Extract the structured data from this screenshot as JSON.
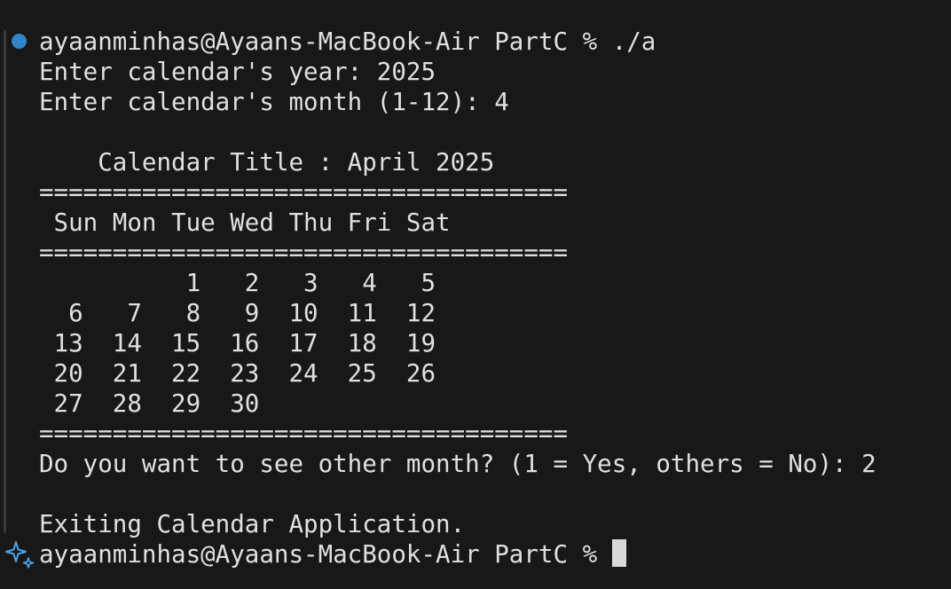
{
  "terminal": {
    "lines": [
      "ayaanminhas@Ayaans-MacBook-Air PartC % ./a",
      "Enter calendar's year: 2025",
      "Enter calendar's month (1-12): 4",
      "",
      "    Calendar Title : April 2025",
      "====================================",
      " Sun Mon Tue Wed Thu Fri Sat",
      "====================================",
      "          1   2   3   4   5",
      "  6   7   8   9  10  11  12",
      " 13  14  15  16  17  18  19",
      " 20  21  22  23  24  25  26",
      " 27  28  29  30",
      "====================================",
      "Do you want to see other month? (1 = Yes, others = No): 2",
      "",
      "Exiting Calendar Application.",
      "ayaanminhas@Ayaans-MacBook-Air PartC % "
    ],
    "status_dot_color": "#2f86c8",
    "prompt_icon": "sparkle-icon"
  }
}
